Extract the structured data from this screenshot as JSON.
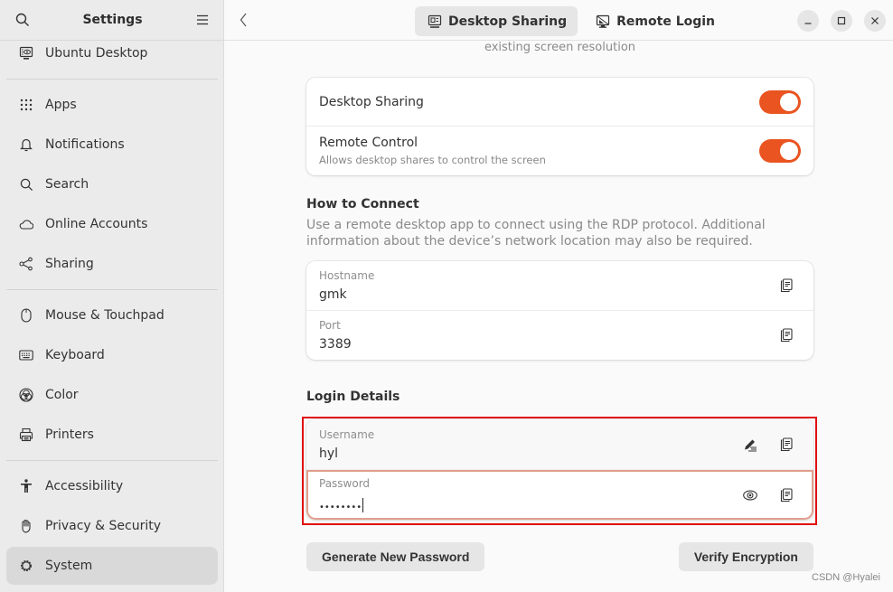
{
  "sidebar": {
    "title": "Settings",
    "search_icon": "search-icon",
    "menu_icon": "hamburger-menu-icon",
    "groups": [
      [
        {
          "label": "Ubuntu Desktop",
          "icon": "ubuntu-desktop-icon"
        }
      ],
      [
        {
          "label": "Apps",
          "icon": "apps-grid-icon"
        },
        {
          "label": "Notifications",
          "icon": "bell-icon"
        },
        {
          "label": "Search",
          "icon": "search-icon"
        },
        {
          "label": "Online Accounts",
          "icon": "cloud-icon"
        },
        {
          "label": "Sharing",
          "icon": "share-icon"
        }
      ],
      [
        {
          "label": "Mouse & Touchpad",
          "icon": "mouse-icon"
        },
        {
          "label": "Keyboard",
          "icon": "keyboard-icon"
        },
        {
          "label": "Color",
          "icon": "color-icon"
        },
        {
          "label": "Printers",
          "icon": "printer-icon"
        }
      ],
      [
        {
          "label": "Accessibility",
          "icon": "accessibility-icon"
        },
        {
          "label": "Privacy & Security",
          "icon": "hand-icon"
        },
        {
          "label": "System",
          "icon": "gear-icon",
          "active": true
        }
      ]
    ]
  },
  "header": {
    "back_icon": "chevron-left-icon",
    "tabs": [
      {
        "label": "Desktop Sharing",
        "icon": "desktop-sharing-icon",
        "active": true
      },
      {
        "label": "Remote Login",
        "icon": "remote-login-icon",
        "active": false
      }
    ],
    "window_controls": [
      "minimize",
      "maximize",
      "close"
    ]
  },
  "main": {
    "top_caption": "existing screen resolution",
    "toggles": [
      {
        "title": "Desktop Sharing",
        "subtitle": "",
        "on": true
      },
      {
        "title": "Remote Control",
        "subtitle": "Allows desktop shares to control the screen",
        "on": true
      }
    ],
    "how_to_connect": {
      "title": "How to Connect",
      "description": "Use a remote desktop app to connect using the RDP protocol. Additional information about the device’s network location may also be required.",
      "fields": [
        {
          "label": "Hostname",
          "value": "gmk"
        },
        {
          "label": "Port",
          "value": "3389"
        }
      ]
    },
    "login_details": {
      "title": "Login Details",
      "username": {
        "label": "Username",
        "value": "hyl"
      },
      "password": {
        "label": "Password",
        "value": "••••••••"
      }
    },
    "buttons": {
      "generate": "Generate New Password",
      "verify": "Verify Encryption"
    },
    "accent_color": "#e95420",
    "highlight_color": "#e01010"
  },
  "watermark": "CSDN @Hyalei"
}
